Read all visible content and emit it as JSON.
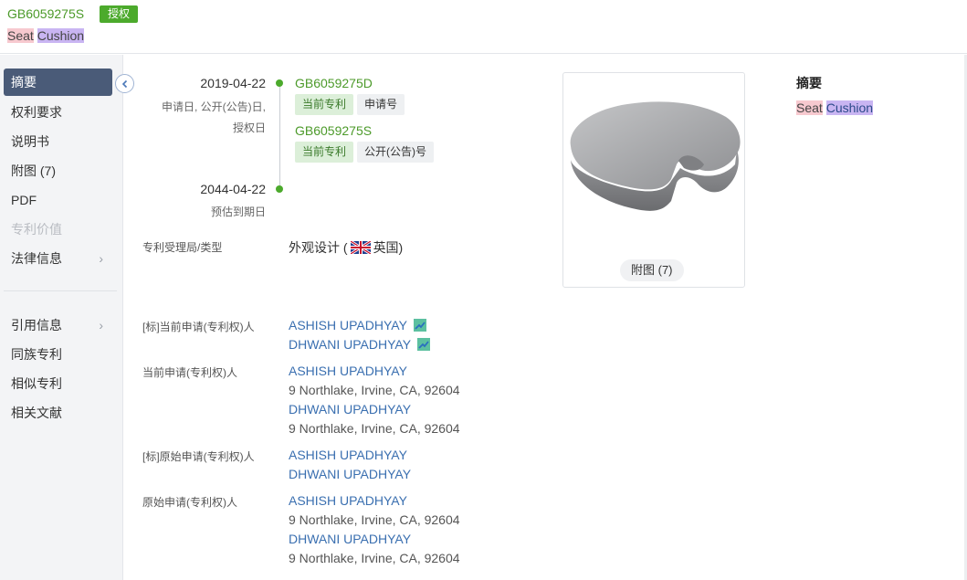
{
  "header": {
    "pub_number": "GB6059275S",
    "status_badge": "授权",
    "title_word1": "Seat",
    "title_word2": "Cushion"
  },
  "sidebar": {
    "items": [
      {
        "label": "摘要",
        "active": true
      },
      {
        "label": "权利要求"
      },
      {
        "label": "说明书"
      },
      {
        "label": "附图 (7)"
      },
      {
        "label": "PDF"
      },
      {
        "label": "专利价值",
        "disabled": true
      },
      {
        "label": "法律信息",
        "chevron": "›"
      },
      {
        "label": "引用信息",
        "chevron": "›"
      },
      {
        "label": "同族专利"
      },
      {
        "label": "相似专利"
      },
      {
        "label": "相关文献"
      }
    ]
  },
  "timeline": {
    "start_date": "2019-04-22",
    "start_sub1": "申请日, 公开(公告)日,",
    "start_sub2": "授权日",
    "app_no": "GB6059275D",
    "tag_current": "当前专利",
    "tag_app": "申请号",
    "pub_no": "GB6059275S",
    "tag_current2": "当前专利",
    "tag_pub": "公开(公告)号",
    "end_date": "2044-04-22",
    "end_sub": "预估到期日"
  },
  "fields": {
    "office_label": "专利受理局/类型",
    "office_value": "外观设计 (",
    "office_country": "英国)",
    "std_current_label": "[标]当前申请(专利权)人",
    "std_current": [
      "ASHISH UPADHYAY",
      "DHWANI UPADHYAY"
    ],
    "current_label": "当前申请(专利权)人",
    "current": [
      {
        "name": "ASHISH UPADHYAY",
        "addr": "9 Northlake, Irvine, CA, 92604"
      },
      {
        "name": "DHWANI UPADHYAY",
        "addr": "9 Northlake, Irvine, CA, 92604"
      }
    ],
    "std_original_label": "[标]原始申请(专利权)人",
    "std_original": [
      "ASHISH UPADHYAY",
      "DHWANI UPADHYAY"
    ],
    "original_label": "原始申请(专利权)人",
    "original": [
      {
        "name": "ASHISH UPADHYAY",
        "addr": "9 Northlake, Irvine, CA, 92604"
      },
      {
        "name": "DHWANI UPADHYAY",
        "addr": "9 Northlake, Irvine, CA, 92604"
      }
    ]
  },
  "figure": {
    "button_label": "附图 (7)"
  },
  "abstract": {
    "title": "摘要",
    "word1": "Seat",
    "word2": "Cushion"
  },
  "colors": {
    "accent_green": "#4caa2c",
    "nav_active": "#4a5b78",
    "link_blue": "#3a6fb0"
  }
}
